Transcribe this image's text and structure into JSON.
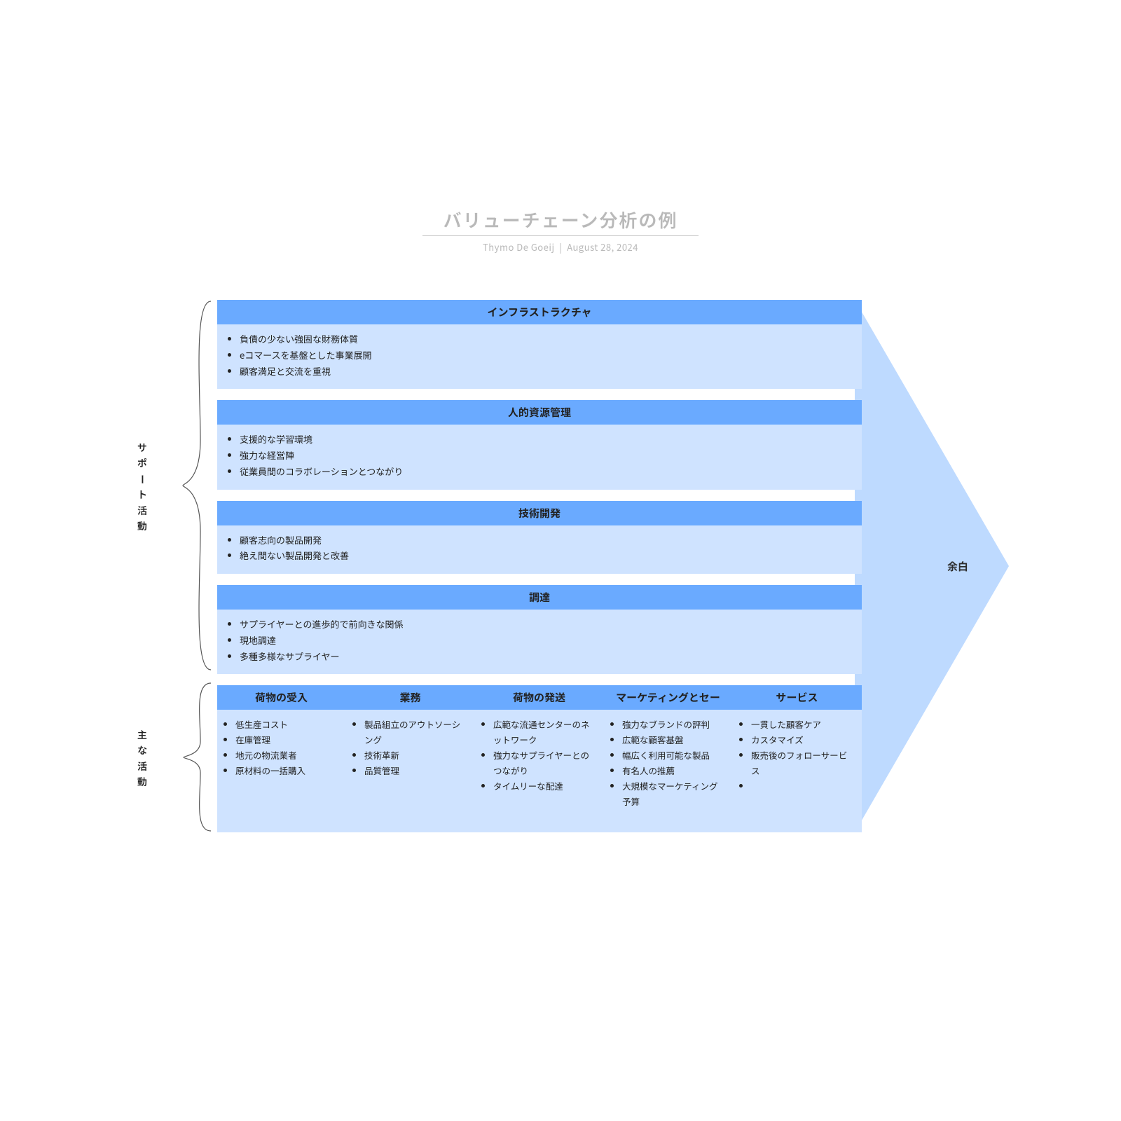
{
  "header": {
    "title": "バリューチェーン分析の例",
    "author": "Thymo De Goeij",
    "date": "August 28, 2024"
  },
  "labels": {
    "support": "サポート活動",
    "primary": "主な活動",
    "margin": "余白"
  },
  "support": [
    {
      "title": "インフラストラクチャ",
      "items": [
        "負債の少ない強固な財務体質",
        "eコマースを基盤とした事業展開",
        "顧客満足と交流を重視"
      ]
    },
    {
      "title": "人的資源管理",
      "items": [
        "支援的な学習環境",
        "強力な経営陣",
        "従業員間のコラボレーションとつながり"
      ]
    },
    {
      "title": "技術開発",
      "items": [
        "顧客志向の製品開発",
        "絶え間ない製品開発と改善"
      ]
    },
    {
      "title": "調達",
      "items": [
        "サプライヤーとの進歩的で前向きな関係",
        "現地調達",
        "多種多様なサプライヤー"
      ]
    }
  ],
  "primary": [
    {
      "title": "荷物の受入",
      "items": [
        "低生産コスト",
        "在庫管理",
        "地元の物流業者",
        "原材料の一括購入"
      ]
    },
    {
      "title": "業務",
      "items": [
        "製品組立のアウトソーシング",
        "技術革新",
        "品質管理"
      ]
    },
    {
      "title": "荷物の発送",
      "items": [
        "広範な流通センターのネットワーク",
        "強力なサプライヤーとのつながり",
        "タイムリーな配達"
      ]
    },
    {
      "title": "マーケティングとセー",
      "items": [
        "強力なブランドの評判",
        "広範な顧客基盤",
        "幅広く利用可能な製品",
        "有名人の推薦",
        "大規模なマーケティング予算"
      ]
    },
    {
      "title": "サービス",
      "items": [
        "一貫した顧客ケア",
        "カスタマイズ",
        "販売後のフォローサービス",
        ""
      ]
    }
  ]
}
